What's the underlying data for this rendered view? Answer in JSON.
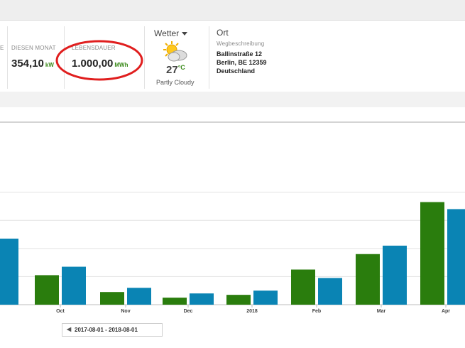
{
  "stats": {
    "partial_left_label": "E",
    "month": {
      "label": "DIESEN MONAT",
      "value": "354,10",
      "unit": "kW"
    },
    "lifetime": {
      "label": "LEBENSDAUER",
      "value": "1.000,00",
      "unit": "MWh"
    }
  },
  "weather": {
    "title": "Wetter",
    "icon": "partly-cloudy-icon",
    "temp": "27",
    "unit": "°C",
    "condition": "Partly Cloudy"
  },
  "location": {
    "title": "Ort",
    "directions": "Wegbeschreibung",
    "address_lines": [
      "Ballinstraße 12",
      "Berlin, BE  12359",
      "Deutschland"
    ]
  },
  "colors": {
    "green": "#2a7d0d",
    "blue": "#0a84b4",
    "accent_unit": "#3a8a1a",
    "annotation": "#e01e1e"
  },
  "chart_data": {
    "type": "bar",
    "categories": [
      "Sep",
      "Oct",
      "Nov",
      "Dec",
      "2018",
      "Feb",
      "Mar",
      "Apr"
    ],
    "category_tick_labels": [
      "p",
      "Oct",
      "Nov",
      "Dec",
      "2018",
      "Feb",
      "Mar",
      "Apr"
    ],
    "series": [
      {
        "values": [
          null,
          21,
          9,
          5,
          7,
          25,
          36,
          73
        ]
      },
      {
        "values": [
          47,
          27,
          12,
          8,
          10,
          19,
          42,
          68
        ]
      }
    ],
    "ylim": [
      0,
      95
    ],
    "grid": true,
    "legend": "none",
    "xlabel": "",
    "ylabel": ""
  },
  "range": {
    "text": "2017-08-01  -  2018-08-01"
  }
}
